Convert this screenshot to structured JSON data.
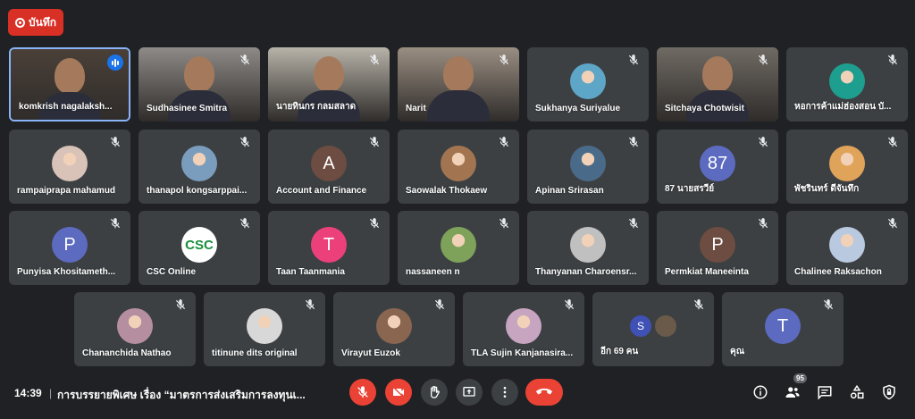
{
  "record": {
    "label": "บันทึก",
    "color": "#d93025"
  },
  "tiles": [
    {
      "name": "komkrish nagalaksh...",
      "type": "video",
      "speaking": true,
      "bg": "#4a4038"
    },
    {
      "name": "Sudhasinee Smitra",
      "type": "video",
      "bg": "#8d8a87"
    },
    {
      "name": "นายทินกร กลมสลาด",
      "type": "video",
      "bg": "#b7b3a9"
    },
    {
      "name": "Narit",
      "type": "video",
      "bg": "#9a8e82"
    },
    {
      "name": "Sukhanya Suriyalue",
      "type": "photo",
      "photo_color": "#5ea6c8"
    },
    {
      "name": "Sitchaya Chotwisit",
      "type": "video",
      "bg": "#6f6a63"
    },
    {
      "name": "หอการค้าแม่ฮ่องสอน บั...",
      "type": "photo",
      "photo_color": "#1e9e8f"
    },
    {
      "name": "rampaiprapa mahamud",
      "type": "photo",
      "photo_color": "#d9c2b8"
    },
    {
      "name": "thanapol kongsarppai...",
      "type": "photo",
      "photo_color": "#7b9dbd"
    },
    {
      "name": "Account and Finance",
      "type": "letter",
      "letter": "A",
      "color": "#6d4c41"
    },
    {
      "name": "Saowalak Thokaew",
      "type": "photo",
      "photo_color": "#a2744f"
    },
    {
      "name": "Apinan Srirasan",
      "type": "photo",
      "photo_color": "#4a6a8a"
    },
    {
      "name": "87 นายสรวีย์",
      "type": "letter",
      "letter": "87",
      "color": "#5c6bc0"
    },
    {
      "name": "พัชรินทร์ ดีจันทึก",
      "type": "photo",
      "photo_color": "#e0a35a"
    },
    {
      "name": "Punyisa Khositameth...",
      "type": "letter",
      "letter": "P",
      "color": "#5c6bc0"
    },
    {
      "name": "CSC Online",
      "type": "csc",
      "letter": "CSC",
      "color": "#ffffff"
    },
    {
      "name": "Taan Taanmania",
      "type": "letter",
      "letter": "T",
      "color": "#ec407a"
    },
    {
      "name": "nassaneen n",
      "type": "photo",
      "photo_color": "#7ea25a"
    },
    {
      "name": "Thanyanan Charoensr...",
      "type": "photo",
      "photo_color": "#c0c0c0"
    },
    {
      "name": "Permkiat Maneeinta",
      "type": "letter",
      "letter": "P",
      "color": "#6d4c41"
    },
    {
      "name": "Chalinee Raksachon",
      "type": "photo",
      "photo_color": "#b9c9e0"
    },
    {
      "name": "Chananchida Nathao",
      "type": "photo",
      "photo_color": "#b58fa0"
    },
    {
      "name": "titinune dits original",
      "type": "photo",
      "photo_color": "#d8d8d8"
    },
    {
      "name": "Virayut Euzok",
      "type": "photo",
      "photo_color": "#8a6650"
    },
    {
      "name": "TLA Sujin Kanjanasira...",
      "type": "photo",
      "photo_color": "#c7a5c0"
    },
    {
      "name": "อีก 69 คน",
      "type": "more",
      "letter": "S",
      "color": "#3f51b5",
      "photo_color": "#6a5a4a"
    },
    {
      "name": "คุณ",
      "type": "letter",
      "letter": "T",
      "color": "#5c6bc0"
    }
  ],
  "bottom": {
    "time": "14:39",
    "separator": "|",
    "title": "การบรรยายพิเศษ เรื่อง “มาตรการส่งเสริมการลงทุนเ...",
    "participants_count": "95"
  },
  "colors": {
    "red": "#ea4335",
    "surface": "#3c4043",
    "background": "#202124",
    "highlight": "#8ab4f8"
  },
  "icons": {
    "controls": [
      "mic-off-icon",
      "camera-off-icon",
      "raise-hand-icon",
      "present-icon",
      "more-options-icon",
      "end-call-icon"
    ],
    "right": [
      "info-icon",
      "people-icon",
      "chat-icon",
      "activities-icon",
      "host-controls-icon"
    ]
  }
}
